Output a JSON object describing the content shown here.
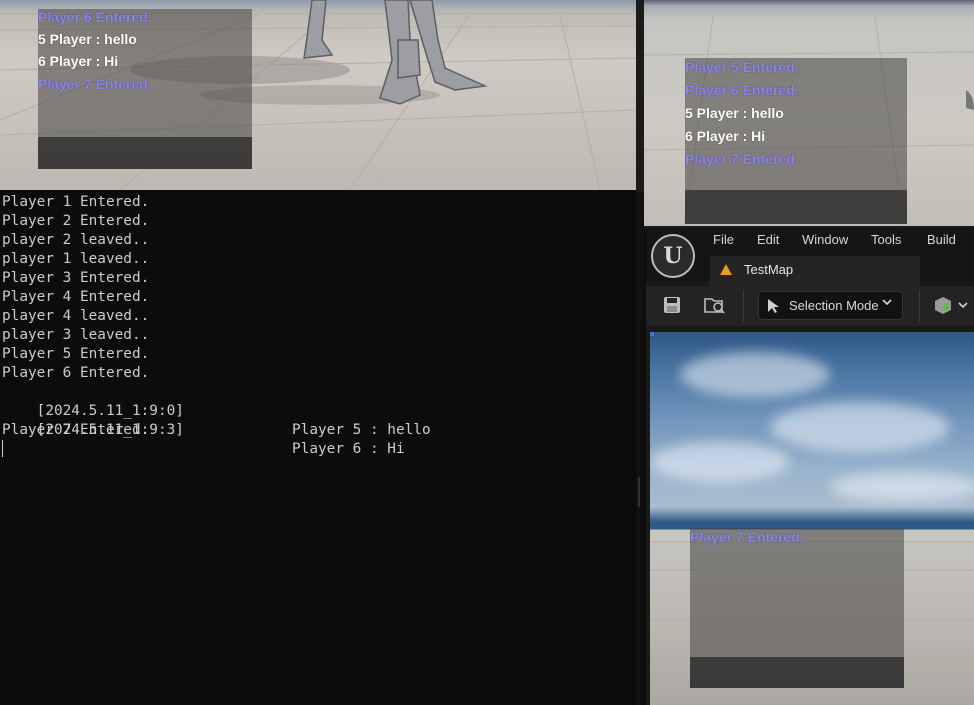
{
  "left_game_chat": {
    "lines": [
      {
        "text": "Player 6 Entered.",
        "kind": "system"
      },
      {
        "text": "5 Player : hello",
        "kind": "message"
      },
      {
        "text": "6 Player : Hi",
        "kind": "message"
      },
      {
        "text": "Player 7 Entered.",
        "kind": "system"
      }
    ]
  },
  "console": {
    "lines": [
      {
        "prefix": "Player 1 Entered.",
        "message": ""
      },
      {
        "prefix": "Player 2 Entered.",
        "message": ""
      },
      {
        "prefix": "player 2 leaved..",
        "message": ""
      },
      {
        "prefix": "player 1 leaved..",
        "message": ""
      },
      {
        "prefix": "Player 3 Entered.",
        "message": ""
      },
      {
        "prefix": "Player 4 Entered.",
        "message": ""
      },
      {
        "prefix": "player 4 leaved..",
        "message": ""
      },
      {
        "prefix": "player 3 leaved..",
        "message": ""
      },
      {
        "prefix": "Player 5 Entered.",
        "message": ""
      },
      {
        "prefix": "Player 6 Entered.",
        "message": ""
      },
      {
        "prefix": "[2024.5.11_1:9:0]",
        "message": "Player 5 : hello"
      },
      {
        "prefix": "[2024.5.11_1:9:3]",
        "message": "Player 6 : Hi"
      },
      {
        "prefix": "Player 7 Entered.",
        "message": ""
      }
    ]
  },
  "right_game_chat": {
    "lines": [
      {
        "text": "Player 5 Entered.",
        "kind": "system"
      },
      {
        "text": "Player 6 Entered.",
        "kind": "system"
      },
      {
        "text": "5 Player : hello",
        "kind": "message"
      },
      {
        "text": "6 Player : Hi",
        "kind": "message"
      },
      {
        "text": "Player 7 Entered.",
        "kind": "system"
      }
    ]
  },
  "editor": {
    "menu": [
      "File",
      "Edit",
      "Window",
      "Tools",
      "Build"
    ],
    "tab_label": "TestMap",
    "selection_mode_label": "Selection Mode",
    "viewport_chat": {
      "lines": [
        {
          "text": "Player 7 Entered.",
          "kind": "system"
        }
      ]
    }
  },
  "icons": {
    "logo": "unreal-logo-icon",
    "save": "save-icon",
    "browse": "content-browser-icon",
    "selection": "cursor-icon",
    "add": "add-actor-icon",
    "map": "map-level-icon"
  },
  "colors": {
    "system_text": "#8a82ee",
    "message_text": "#ffffff",
    "console_bg": "#0c0c0c",
    "console_text": "#cccccc",
    "map_icon": "#e59a2a"
  }
}
